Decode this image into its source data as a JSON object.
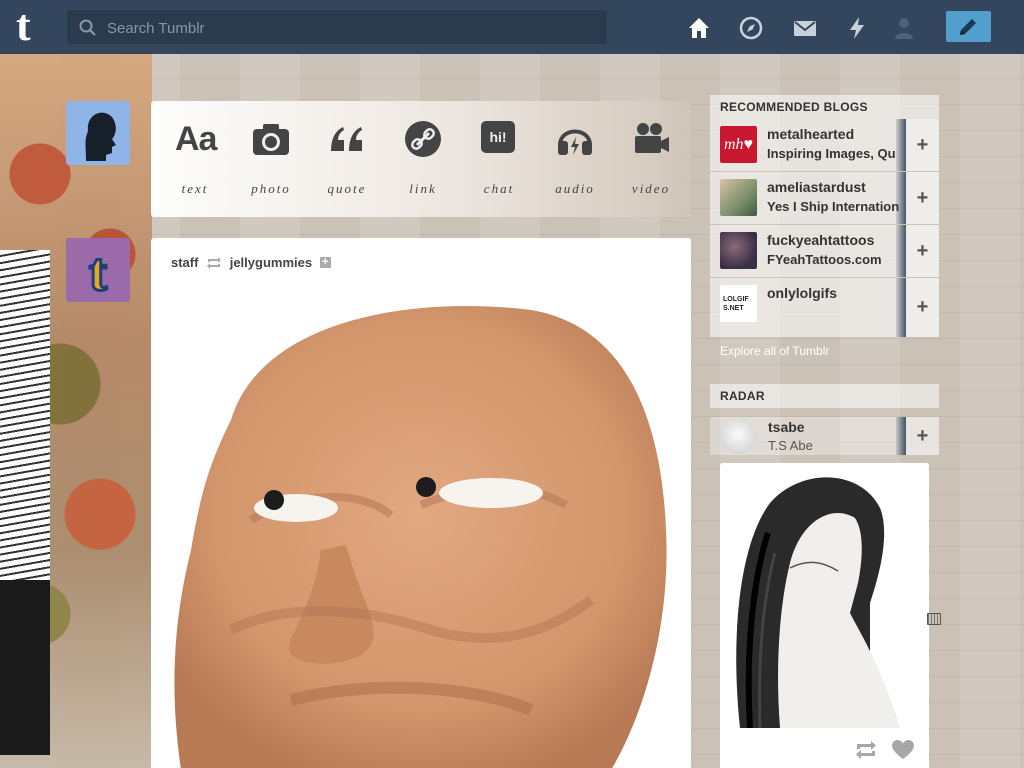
{
  "topbar": {
    "logo": "t",
    "search_placeholder": "Search Tumblr",
    "nav_icons": [
      "home-icon",
      "compass-icon",
      "mail-icon",
      "lightning-icon",
      "person-icon",
      "pencil-icon"
    ]
  },
  "composer": {
    "types": [
      {
        "label": "text",
        "glyph": "Aa"
      },
      {
        "label": "photo"
      },
      {
        "label": "quote"
      },
      {
        "label": "link"
      },
      {
        "label": "chat",
        "glyph": "hi!"
      },
      {
        "label": "audio"
      },
      {
        "label": "video"
      }
    ]
  },
  "post": {
    "author": "staff",
    "reblogged_from": "jellygummies"
  },
  "sidebar": {
    "recommended_title": "RECOMMENDED BLOGS",
    "blogs": [
      {
        "name": "metalhearted",
        "desc": "Inspiring Images, Qu",
        "thumb_text": "mh♥"
      },
      {
        "name": "ameliastardust",
        "desc": "Yes I Ship Internation"
      },
      {
        "name": "fuckyeahtattoos",
        "desc": "FYeahTattoos.com"
      },
      {
        "name": "onlylolgifs",
        "desc": "",
        "thumb_text": "LOLGIFS.NET"
      }
    ],
    "explore": "Explore all of Tumblr",
    "radar_title": "RADAR",
    "radar_blog": {
      "name": "tsabe",
      "desc": "T.S Abe"
    }
  },
  "colors": {
    "topbar": "#34465d",
    "compose": "#529ecc",
    "page_bg": "#cfc6bc"
  }
}
